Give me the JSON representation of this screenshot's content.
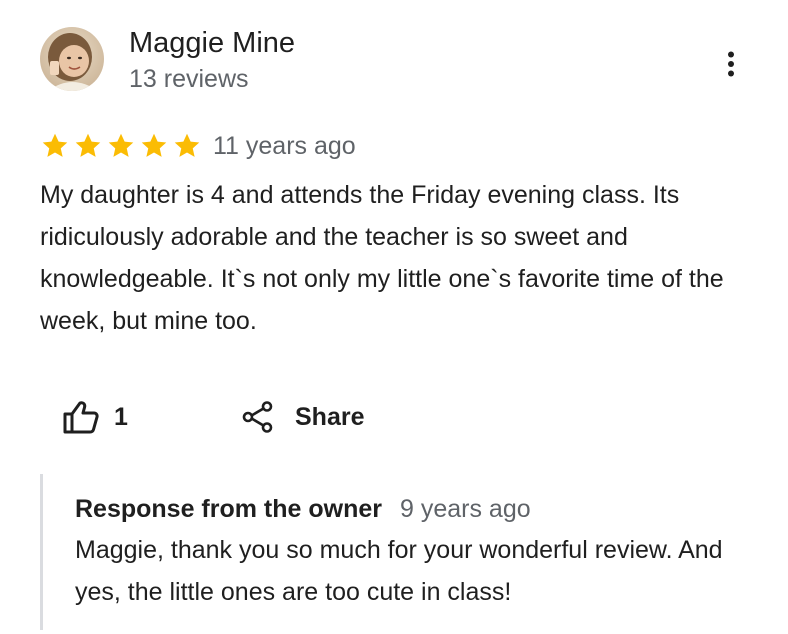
{
  "reviewer": {
    "name": "Maggie Mine",
    "review_count": "13 reviews",
    "avatar_icon": "person-avatar"
  },
  "menu": {
    "icon": "more-vert-icon"
  },
  "review": {
    "rating": 5,
    "rating_max": 5,
    "star_color": "#fbbc04",
    "date": "11 years ago",
    "text": "My daughter is 4 and attends the Friday evening class. Its ridiculously adorable and the teacher is so sweet and knowledgeable. It`s not only my little one`s favorite time of the week, but mine too."
  },
  "actions": {
    "like_icon": "thumb-up-icon",
    "like_count": "1",
    "share_icon": "share-icon",
    "share_label": "Share"
  },
  "owner_response": {
    "title": "Response from the owner",
    "date": "9 years ago",
    "text": "Maggie, thank you so much for your wonderful review. And yes, the little ones are too cute in class!"
  },
  "colors": {
    "text_primary": "#1f1f1f",
    "text_secondary": "#5f6368",
    "divider": "#dadce0"
  }
}
